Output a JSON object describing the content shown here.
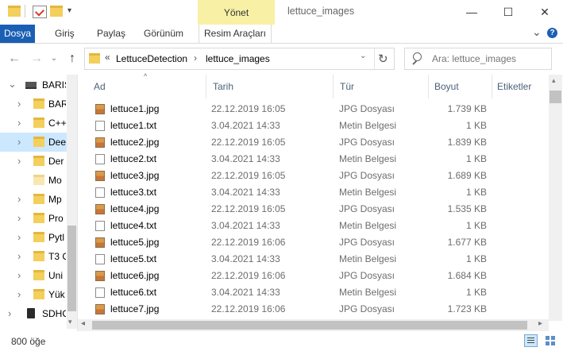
{
  "titlebar": {
    "context_tab": "Yönet",
    "window_title": "lettuce_images",
    "minimize": "—",
    "maximize": "☐",
    "close": "✕"
  },
  "ribbon": {
    "tabs": [
      {
        "label": "Dosya"
      },
      {
        "label": "Giriş"
      },
      {
        "label": "Paylaş"
      },
      {
        "label": "Görünüm"
      },
      {
        "label": "Resim Araçları"
      }
    ],
    "collapse": "⌄",
    "help": "?"
  },
  "address": {
    "overflow": "«",
    "crumbs": [
      "LettuceDetection",
      "lettuce_images"
    ],
    "separator": "›",
    "refresh": "↻"
  },
  "search": {
    "placeholder": "Ara: lettuce_images"
  },
  "navpane": {
    "items": [
      {
        "label": "BARIS"
      },
      {
        "label": "BAR"
      },
      {
        "label": "C++"
      },
      {
        "label": "Dee"
      },
      {
        "label": "Der"
      },
      {
        "label": "Mo"
      },
      {
        "label": "Mp"
      },
      {
        "label": "Pro"
      },
      {
        "label": "Pytl"
      },
      {
        "label": "T3 C"
      },
      {
        "label": "Uni"
      },
      {
        "label": "Yük"
      },
      {
        "label": "SDHC"
      }
    ]
  },
  "columns": {
    "name": "Ad",
    "date": "Tarih",
    "type": "Tür",
    "size": "Boyut",
    "tags": "Etiketler"
  },
  "files": [
    {
      "name": "lettuce1.jpg",
      "date": "22.12.2019 16:05",
      "type": "JPG Dosyası",
      "size": "1.739 KB",
      "kind": "jpg"
    },
    {
      "name": "lettuce1.txt",
      "date": "3.04.2021 14:33",
      "type": "Metin Belgesi",
      "size": "1 KB",
      "kind": "txt"
    },
    {
      "name": "lettuce2.jpg",
      "date": "22.12.2019 16:05",
      "type": "JPG Dosyası",
      "size": "1.839 KB",
      "kind": "jpg"
    },
    {
      "name": "lettuce2.txt",
      "date": "3.04.2021 14:33",
      "type": "Metin Belgesi",
      "size": "1 KB",
      "kind": "txt"
    },
    {
      "name": "lettuce3.jpg",
      "date": "22.12.2019 16:05",
      "type": "JPG Dosyası",
      "size": "1.689 KB",
      "kind": "jpg"
    },
    {
      "name": "lettuce3.txt",
      "date": "3.04.2021 14:33",
      "type": "Metin Belgesi",
      "size": "1 KB",
      "kind": "txt"
    },
    {
      "name": "lettuce4.jpg",
      "date": "22.12.2019 16:05",
      "type": "JPG Dosyası",
      "size": "1.535 KB",
      "kind": "jpg"
    },
    {
      "name": "lettuce4.txt",
      "date": "3.04.2021 14:33",
      "type": "Metin Belgesi",
      "size": "1 KB",
      "kind": "txt"
    },
    {
      "name": "lettuce5.jpg",
      "date": "22.12.2019 16:06",
      "type": "JPG Dosyası",
      "size": "1.677 KB",
      "kind": "jpg"
    },
    {
      "name": "lettuce5.txt",
      "date": "3.04.2021 14:33",
      "type": "Metin Belgesi",
      "size": "1 KB",
      "kind": "txt"
    },
    {
      "name": "lettuce6.jpg",
      "date": "22.12.2019 16:06",
      "type": "JPG Dosyası",
      "size": "1.684 KB",
      "kind": "jpg"
    },
    {
      "name": "lettuce6.txt",
      "date": "3.04.2021 14:33",
      "type": "Metin Belgesi",
      "size": "1 KB",
      "kind": "txt"
    },
    {
      "name": "lettuce7.jpg",
      "date": "22.12.2019 16:06",
      "type": "JPG Dosyası",
      "size": "1.723 KB",
      "kind": "jpg"
    }
  ],
  "statusbar": {
    "count": "800 öğe"
  },
  "colors": {
    "accent": "#1a5fb4",
    "context_tab": "#f8f0a4",
    "selection": "#cce8ff"
  }
}
